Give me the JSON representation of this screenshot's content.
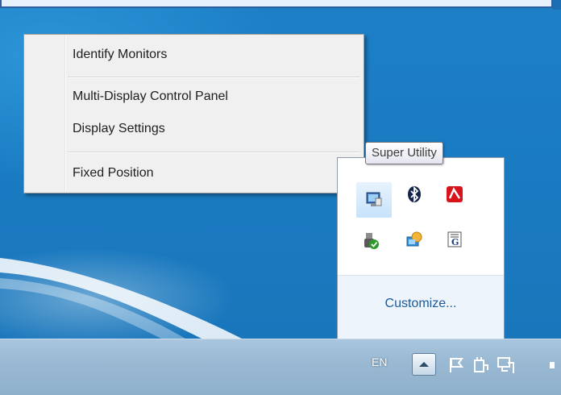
{
  "context_menu": {
    "items": [
      {
        "label": "Identify Monitors"
      },
      {
        "label": "Multi-Display Control Panel"
      },
      {
        "label": "Display Settings"
      },
      {
        "label": "Fixed Position"
      }
    ]
  },
  "tooltip": {
    "text": "Super Utility"
  },
  "tray_popup": {
    "icons": [
      {
        "name": "super-utility-icon",
        "selected": true
      },
      {
        "name": "bluetooth-icon"
      },
      {
        "name": "avira-antivirus-icon"
      },
      {
        "name": "safely-remove-hardware-icon"
      },
      {
        "name": "network-globe-icon"
      },
      {
        "name": "graphics-driver-icon"
      }
    ],
    "customize_label": "Customize..."
  },
  "taskbar": {
    "language": "EN",
    "system_icons": [
      "show-hidden-icons-button",
      "action-center-flag-icon",
      "power-plug-icon",
      "network-icon"
    ]
  },
  "colors": {
    "desktop_blue": "#1b82c8",
    "link": "#1c5b9a",
    "taskbar": "#9ab9d3"
  }
}
